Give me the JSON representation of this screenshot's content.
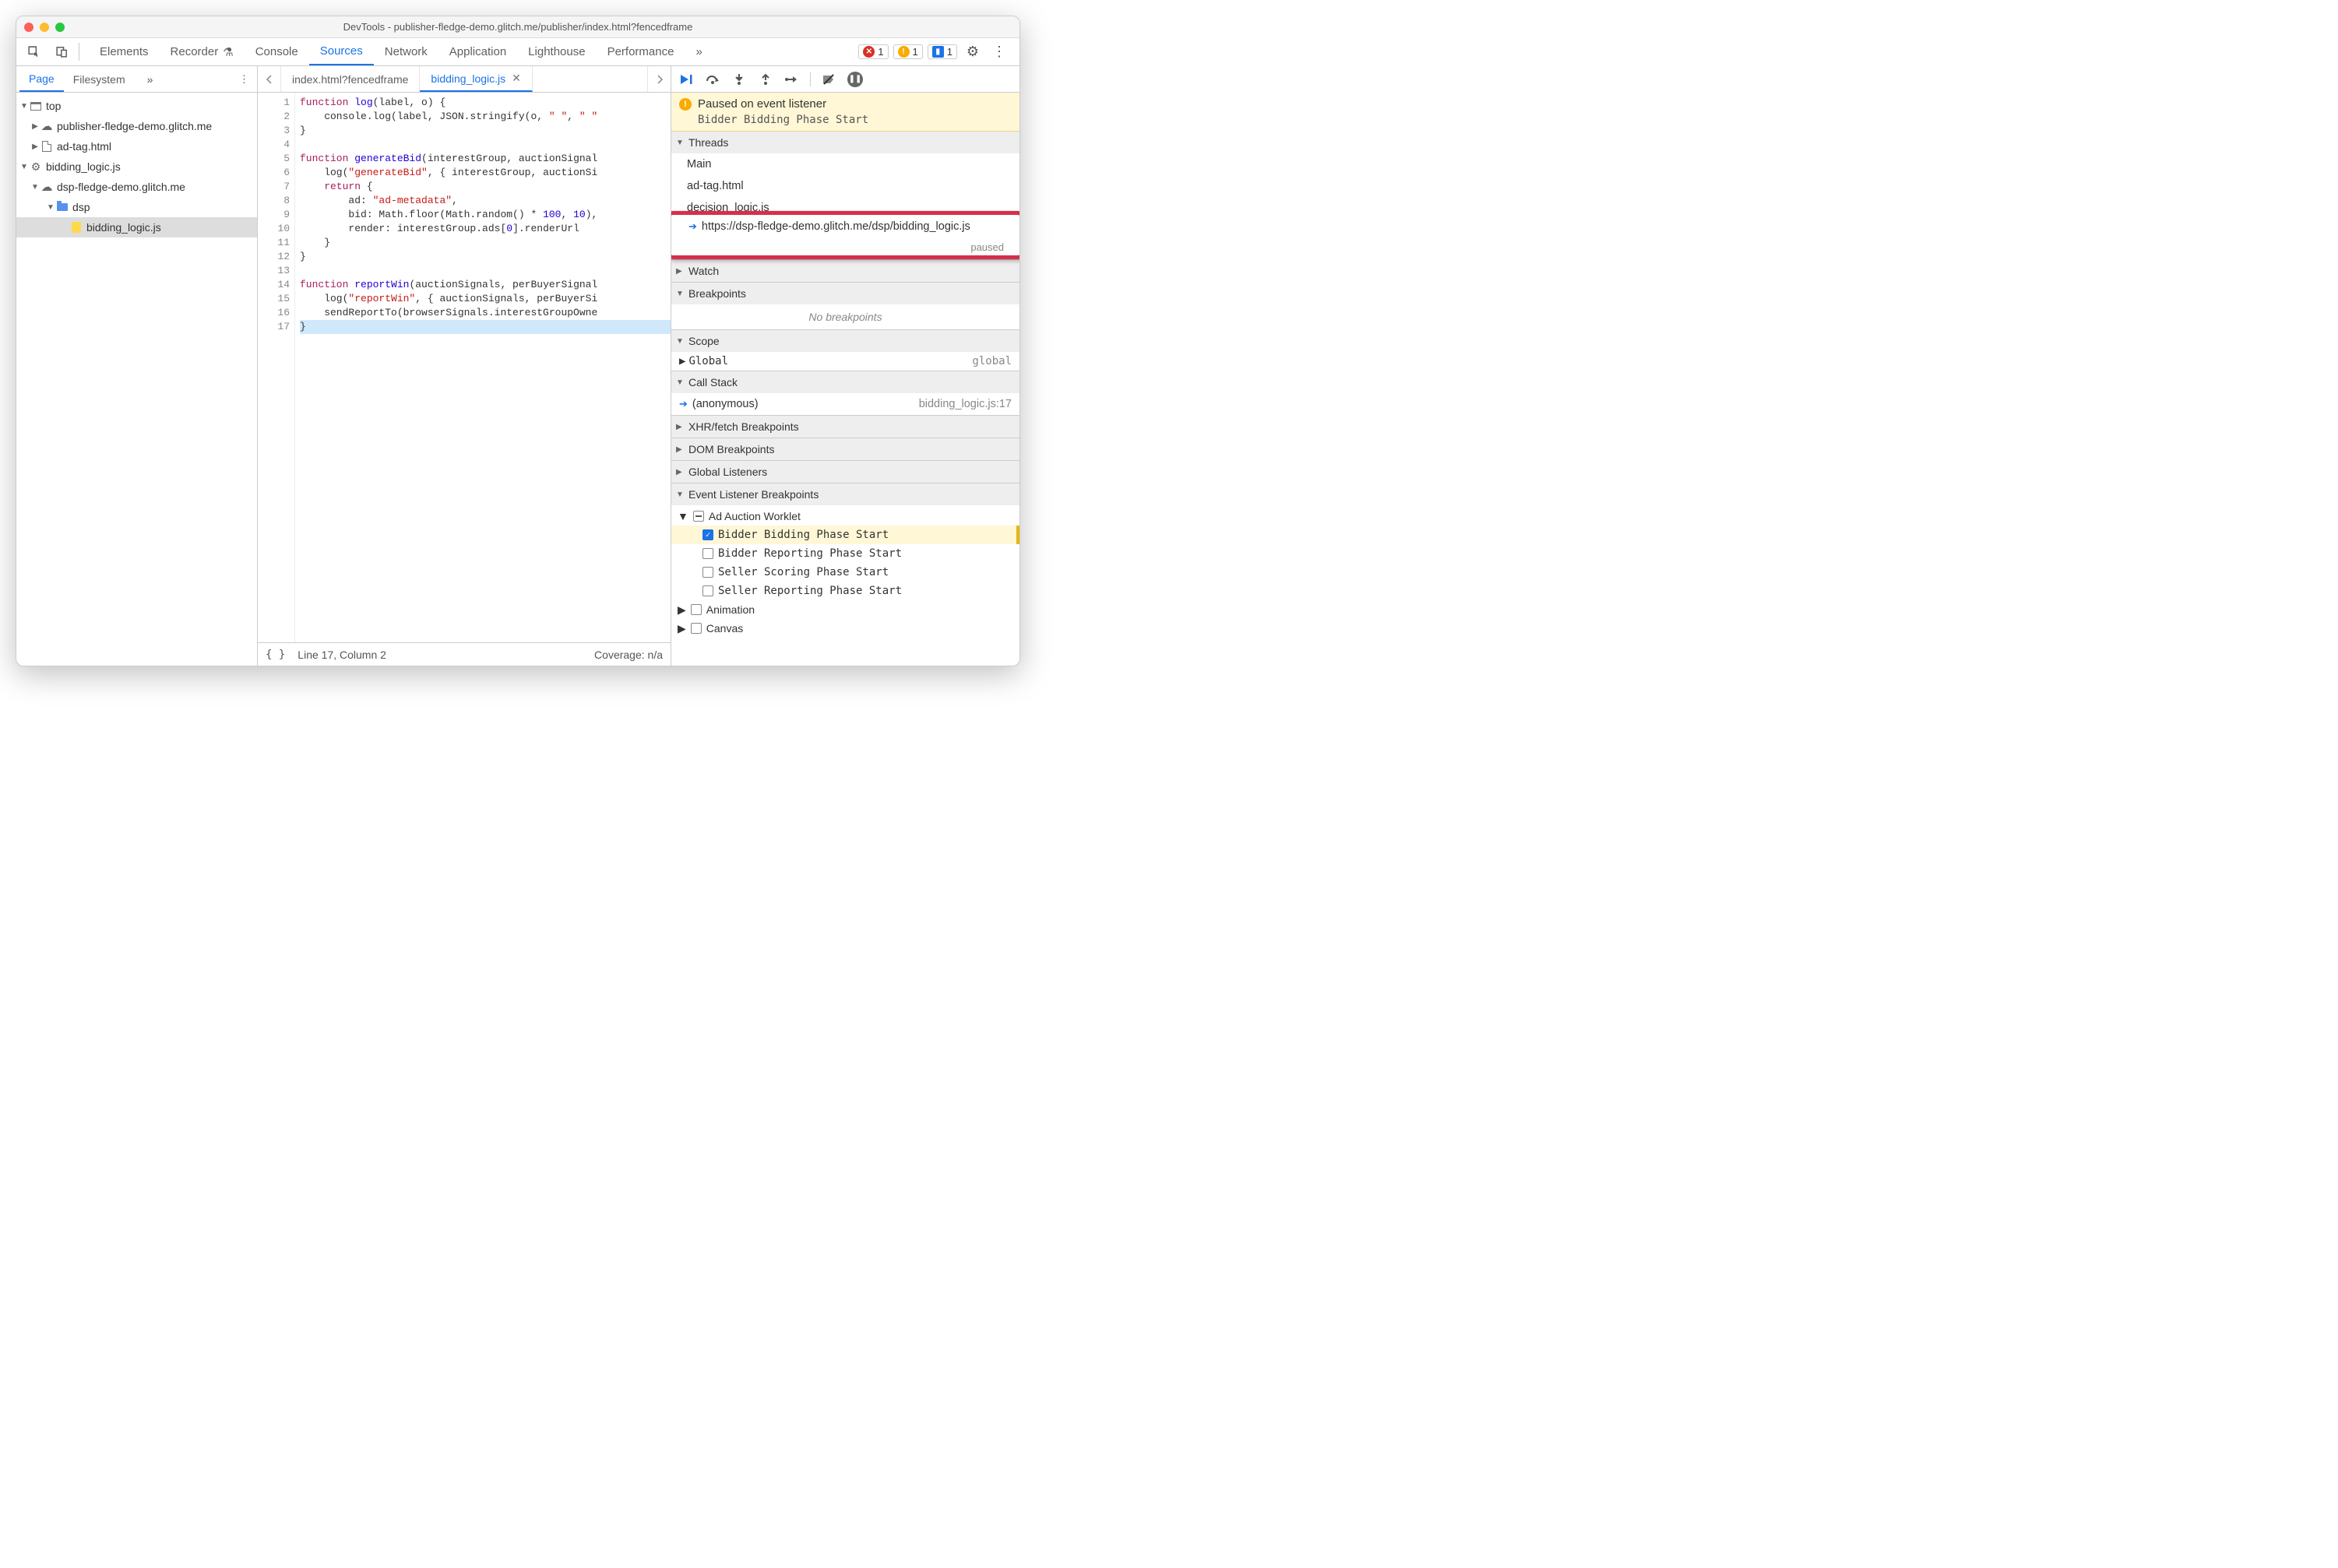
{
  "window": {
    "title": "DevTools - publisher-fledge-demo.glitch.me/publisher/index.html?fencedframe"
  },
  "toolbar": {
    "tabs": [
      "Elements",
      "Recorder",
      "Console",
      "Sources",
      "Network",
      "Application",
      "Lighthouse",
      "Performance"
    ],
    "activeTab": "Sources",
    "errors": "1",
    "warnings": "1",
    "info": "1"
  },
  "left": {
    "subtabs": [
      "Page",
      "Filesystem"
    ],
    "activeSubtab": "Page",
    "tree": {
      "top": "top",
      "pub": "publisher-fledge-demo.glitch.me",
      "adtag": "ad-tag.html",
      "worklet": "bidding_logic.js",
      "dsp_origin": "dsp-fledge-demo.glitch.me",
      "dsp_folder": "dsp",
      "dsp_file": "bidding_logic.js"
    }
  },
  "center": {
    "tabs": [
      {
        "name": "index.html?fencedframe",
        "active": false
      },
      {
        "name": "bidding_logic.js",
        "active": true
      }
    ],
    "status": {
      "cursor": "Line 17, Column 2",
      "coverage": "Coverage: n/a"
    }
  },
  "code": {
    "lines": [
      [
        {
          "t": "function ",
          "c": "kw"
        },
        {
          "t": "log",
          "c": "fn"
        },
        {
          "t": "(label, o) {"
        }
      ],
      [
        {
          "t": "    console.log(label, JSON.stringify(o, "
        },
        {
          "t": "\" \"",
          "c": "str"
        },
        {
          "t": ", "
        },
        {
          "t": "\" \"",
          "c": "str"
        }
      ],
      [
        {
          "t": "}"
        }
      ],
      [
        {
          "t": ""
        }
      ],
      [
        {
          "t": "function ",
          "c": "kw"
        },
        {
          "t": "generateBid",
          "c": "fn"
        },
        {
          "t": "(interestGroup, auctionSignal"
        }
      ],
      [
        {
          "t": "    log("
        },
        {
          "t": "\"generateBid\"",
          "c": "str"
        },
        {
          "t": ", { interestGroup, auctionSi"
        }
      ],
      [
        {
          "t": "    "
        },
        {
          "t": "return",
          "c": "kw"
        },
        {
          "t": " {"
        }
      ],
      [
        {
          "t": "        ad: "
        },
        {
          "t": "\"ad-metadata\"",
          "c": "str"
        },
        {
          "t": ","
        }
      ],
      [
        {
          "t": "        bid: Math.floor(Math.random() * "
        },
        {
          "t": "100",
          "c": "num"
        },
        {
          "t": ", "
        },
        {
          "t": "10",
          "c": "num"
        },
        {
          "t": "),"
        }
      ],
      [
        {
          "t": "        render: interestGroup.ads["
        },
        {
          "t": "0",
          "c": "num"
        },
        {
          "t": "].renderUrl"
        }
      ],
      [
        {
          "t": "    }"
        }
      ],
      [
        {
          "t": "}"
        }
      ],
      [
        {
          "t": ""
        }
      ],
      [
        {
          "t": "function ",
          "c": "kw"
        },
        {
          "t": "reportWin",
          "c": "fn"
        },
        {
          "t": "(auctionSignals, perBuyerSignal"
        }
      ],
      [
        {
          "t": "    log("
        },
        {
          "t": "\"reportWin\"",
          "c": "str"
        },
        {
          "t": ", { auctionSignals, perBuyerSi"
        }
      ],
      [
        {
          "t": "    sendReportTo(browserSignals.interestGroupOwne"
        }
      ],
      [
        {
          "t": "}"
        }
      ]
    ]
  },
  "right": {
    "paused": {
      "title": "Paused on event listener",
      "sub": "Bidder Bidding Phase Start"
    },
    "threads": {
      "header": "Threads",
      "items": [
        "Main",
        "ad-tag.html",
        "decision_logic.js"
      ],
      "highlighted": "https://dsp-fledge-demo.glitch.me/dsp/bidding_logic.js",
      "highlighted_status": "paused"
    },
    "watch": "Watch",
    "breakpoints": {
      "header": "Breakpoints",
      "empty": "No breakpoints"
    },
    "scope": {
      "header": "Scope",
      "global_label": "Global",
      "global_val": "global"
    },
    "callstack": {
      "header": "Call Stack",
      "frame": "(anonymous)",
      "loc": "bidding_logic.js:17"
    },
    "xhr": "XHR/fetch Breakpoints",
    "dom": "DOM Breakpoints",
    "globals": "Global Listeners",
    "events": {
      "header": "Event Listener Breakpoints",
      "adAuction": "Ad Auction Worklet",
      "items": [
        {
          "label": "Bidder Bidding Phase Start",
          "checked": true
        },
        {
          "label": "Bidder Reporting Phase Start",
          "checked": false
        },
        {
          "label": "Seller Scoring Phase Start",
          "checked": false
        },
        {
          "label": "Seller Reporting Phase Start",
          "checked": false
        }
      ],
      "animation": "Animation",
      "canvas": "Canvas"
    }
  }
}
